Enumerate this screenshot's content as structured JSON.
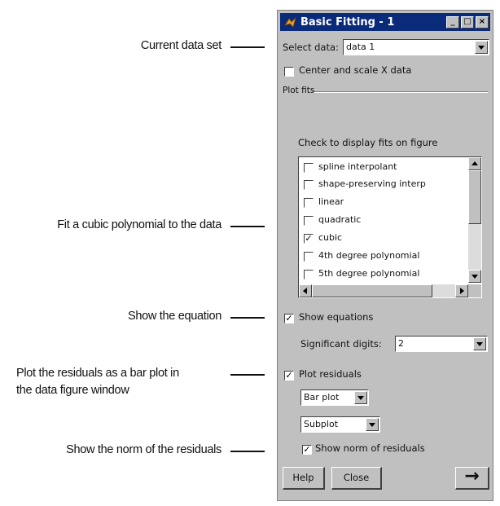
{
  "callouts": {
    "current_data_set": "Current data set",
    "fit_cubic": "Fit a cubic polynomial to the data",
    "show_equation": "Show the equation",
    "plot_residuals_1": "Plot the residuals as a bar plot in",
    "plot_residuals_2": "the data figure window",
    "show_norm": "Show the norm of the residuals"
  },
  "window": {
    "title": "Basic Fitting - 1",
    "titlebar_buttons": [
      "minimize-icon",
      "maximize-icon",
      "close-icon"
    ],
    "select_data_label": "Select data:",
    "select_data_value": "data 1",
    "center_scale_label": "Center and scale X data",
    "center_scale_checked": false,
    "plot_fits_group": "Plot fits",
    "check_to_display": "Check to display fits on figure",
    "fits": [
      {
        "label": "spline interpolant",
        "checked": false
      },
      {
        "label": "shape-preserving interp",
        "checked": false
      },
      {
        "label": "linear",
        "checked": false
      },
      {
        "label": "quadratic",
        "checked": false
      },
      {
        "label": "cubic",
        "checked": true
      },
      {
        "label": "4th degree polynomial",
        "checked": false
      },
      {
        "label": "5th degree polynomial",
        "checked": false
      }
    ],
    "show_equations_label": "Show equations",
    "show_equations_checked": true,
    "significant_digits_label": "Significant digits:",
    "significant_digits_value": "2",
    "plot_residuals_label": "Plot residuals",
    "plot_residuals_checked": true,
    "plot_style_value": "Bar plot",
    "plot_location_value": "Subplot",
    "show_norm_label": "Show norm of residuals",
    "show_norm_checked": true,
    "help_label": "Help",
    "close_label": "Close",
    "next_icon": "right-arrow-icon"
  },
  "colors": {
    "titlebar": "#0a2a7a",
    "window_bg": "#c0c0c0",
    "app_icon": "#e8a020"
  }
}
